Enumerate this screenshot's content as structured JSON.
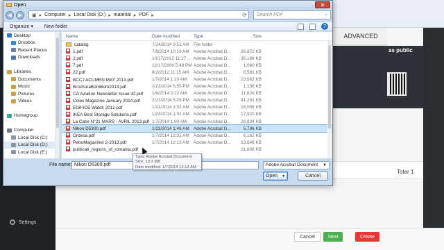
{
  "background": {
    "tab_advanced": "ADVANCED",
    "share_text": "as public",
    "total_label": "Totar",
    "total_value": "1",
    "settings_label": "Settings",
    "cancel_label": "Cancel",
    "next_label": "Next",
    "create_label": "Create"
  },
  "dialog": {
    "title": "Open",
    "close_glyph": "✕",
    "breadcrumb": [
      "Computer",
      "Local Disk (D:)",
      "material",
      "PDF"
    ],
    "search_placeholder": "Search PDF",
    "toolbar": {
      "organize": "Organize ▾",
      "new_folder": "New folder",
      "help": "?"
    },
    "nav": [
      {
        "label": "Desktop",
        "color": "#3b78c4"
      },
      {
        "label": "Dropbox",
        "color": "#2f88d8"
      },
      {
        "label": "Recent Places",
        "color": "#6b7fa0"
      },
      {
        "label": "Downloads",
        "color": "#4a78b0"
      },
      {
        "label": "",
        "color": "transparent"
      },
      {
        "label": "Libraries",
        "color": "#c7a24a"
      },
      {
        "label": "Documents",
        "color": "#c7a24a"
      },
      {
        "label": "Music",
        "color": "#c7a24a"
      },
      {
        "label": "Pictures",
        "color": "#c7a24a"
      },
      {
        "label": "Videos",
        "color": "#c7a24a"
      },
      {
        "label": "",
        "color": "transparent"
      },
      {
        "label": "Homegroup",
        "color": "#3aa0a0"
      },
      {
        "label": "",
        "color": "transparent"
      },
      {
        "label": "Computer",
        "color": "#6d7c8e"
      },
      {
        "label": "Local Disk (C:)",
        "color": "#8a96a5"
      },
      {
        "label": "Local Disk (D:)",
        "color": "#8a96a5",
        "selected": true
      },
      {
        "label": "Local Disk (E:)",
        "color": "#8a96a5"
      }
    ],
    "columns": {
      "name": "Name",
      "date": "Date modified",
      "type": "Type",
      "size": "Size"
    },
    "files": [
      {
        "name": "catalog",
        "date": "7/24/2014 9:51 AM",
        "type": "File folder",
        "size": "",
        "kind": "folder"
      },
      {
        "name": "1.pdf",
        "date": "7/8/2014 10:10 AM",
        "type": "Adobe Acrobat D...",
        "size": "26,872 KB",
        "kind": "pdf"
      },
      {
        "name": "2.pdf",
        "date": "10/17/2012 11:27 ...",
        "type": "Adobe Acrobat D...",
        "size": "35,166 KB",
        "kind": "pdf"
      },
      {
        "name": "7.pdf",
        "date": "12/17/2009 5:48 PM",
        "type": "Adobe Acrobat D...",
        "size": "1,060 KB",
        "kind": "pdf"
      },
      {
        "name": "22.pdf",
        "date": "8/2/2012 11:15 AM",
        "type": "Adobe Acrobat D...",
        "size": "6,581 KB",
        "kind": "pdf"
      },
      {
        "name": "BCCJ ACUMEN MAY 2013.pdf",
        "date": "1/7/2014 1:10 AM",
        "type": "Adobe Acrobat D...",
        "size": "23,682 KB",
        "kind": "pdf"
      },
      {
        "name": "BrochuraBomBom2013.pdf",
        "date": "2/23/2014 6:55 PM",
        "type": "Adobe Acrobat D...",
        "size": "1,136 KB",
        "kind": "pdf"
      },
      {
        "name": "CA Aviation Newsletter Issue 32.pdf",
        "date": "1/6/2014 2:22 AM",
        "type": "Adobe Acrobat D...",
        "size": "11,626 KB",
        "kind": "pdf"
      },
      {
        "name": "Coles Magazine January 2014.pdf",
        "date": "2/23/2014 5:28 PM",
        "type": "Adobe Acrobat D...",
        "size": "41,281 KB",
        "kind": "pdf"
      },
      {
        "name": "EDIFICE Watch 2012.pdf",
        "date": "1/23/2014 1:02 AM",
        "type": "Adobe Acrobat D...",
        "size": "16,056 KB",
        "kind": "pdf"
      },
      {
        "name": "IKEA Best Storage Solutions.pdf",
        "date": "1/23/2014 1:02 AM",
        "type": "Adobe Acrobat D...",
        "size": "17,920 KB",
        "kind": "pdf"
      },
      {
        "name": "La Case N°21  MARS - AVRIL 2013.pdf",
        "date": "1/7/2014 1:00 AM",
        "type": "Adobe Acrobat D...",
        "size": "26,824 KB",
        "kind": "pdf"
      },
      {
        "name": "Nikon D5300.pdf",
        "date": "1/23/2014 1:46 AM",
        "type": "Adobe Acrobat D...",
        "size": "5,786 KB",
        "kind": "pdf",
        "selected": true
      },
      {
        "name": "Ordesa.pdf",
        "date": "1/7/2014 12:02 AM",
        "type": "Adobe Acrobat D...",
        "size": "6,162 KB",
        "kind": "pdf"
      },
      {
        "name": "PetroMagasinet 2-2013.pdf",
        "date": "1/7/2014 12:13 AM",
        "type": "Adobe Acrobat D...",
        "size": "13,648 KB",
        "kind": "pdf"
      },
      {
        "name": "publicati_regions_of_romania.pdf",
        "date": "",
        "type": "",
        "size": "21,606 KB",
        "kind": "pdf"
      }
    ],
    "tooltip": {
      "type": "Type: Adobe Acrobat Document",
      "size": "Size: 13.3 MB",
      "date": "Date modified: 1/7/2014 12:13 AM"
    },
    "filename_label": "File name:",
    "filename_value": "Nikon D5300.pdf",
    "filetype_value": "Adobe Acrobat Document",
    "open_label": "Open",
    "cancel_label": "Cancel"
  }
}
